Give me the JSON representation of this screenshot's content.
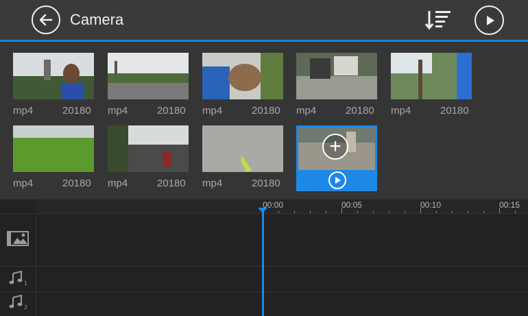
{
  "header": {
    "title": "Camera",
    "back_icon": "back-arrow-icon",
    "sort_icon": "sort-icon",
    "play_icon": "play-icon"
  },
  "media": [
    {
      "ext": "mp4",
      "date": "20180",
      "scene": "fountain-selfie"
    },
    {
      "ext": "mp4",
      "date": "20180",
      "scene": "street-road"
    },
    {
      "ext": "mp4",
      "date": "20180",
      "scene": "face-closeup"
    },
    {
      "ext": "mp4",
      "date": "20180",
      "scene": "house-gate"
    },
    {
      "ext": "mp4",
      "date": "20180",
      "scene": "trees-sky"
    },
    {
      "ext": "mp4",
      "date": "20180",
      "scene": "grass-field"
    },
    {
      "ext": "mp4",
      "date": "20180",
      "scene": "road-motorbike"
    },
    {
      "ext": "mp4",
      "date": "20180",
      "scene": "pavement-shoe"
    },
    {
      "ext": "",
      "date": "",
      "scene": "feet-ground",
      "selected": true
    }
  ],
  "timeline": {
    "ruler": [
      "00:00",
      "00:05",
      "00:10",
      "00:15"
    ]
  },
  "colors": {
    "accent": "#1e88e5",
    "header_bg": "#3a3a3a"
  }
}
